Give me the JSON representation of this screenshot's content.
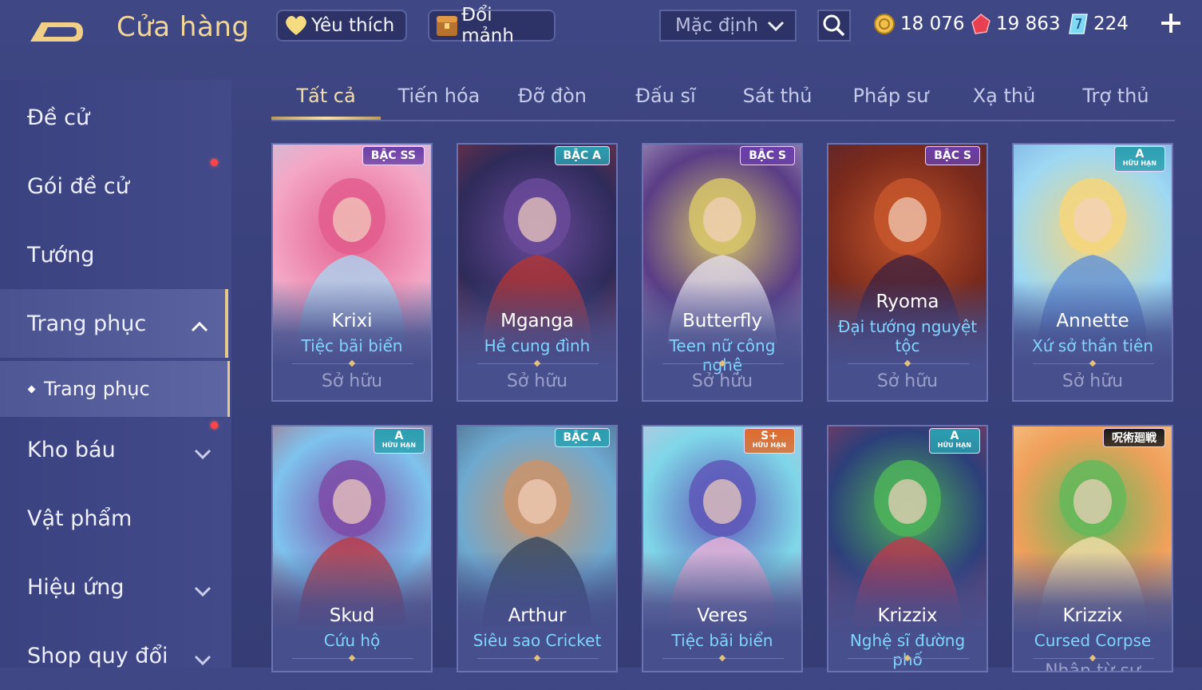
{
  "header": {
    "title": "Cửa hàng",
    "favorites_label": "Yêu thích",
    "exchange_label": "Đổi mảnh",
    "sort_value": "Mặc định",
    "gold": "18 076",
    "rubies": "19 863",
    "vouchers": "224"
  },
  "sidebar": {
    "items": [
      {
        "label": "Đề cử"
      },
      {
        "label": "Gói đề cử"
      },
      {
        "label": "Tướng"
      },
      {
        "label": "Trang phục"
      },
      {
        "label": "Kho báu"
      },
      {
        "label": "Vật phẩm"
      },
      {
        "label": "Hiệu ứng"
      },
      {
        "label": "Shop quy đổi"
      }
    ],
    "subitem": "Trang phục"
  },
  "tabs": [
    "Tất cả",
    "Tiến hóa",
    "Đỡ đòn",
    "Đấu sĩ",
    "Sát thủ",
    "Pháp sư",
    "Xạ thủ",
    "Trợ thủ"
  ],
  "cards": [
    {
      "hero": "Krixi",
      "skin": "Tiệc bãi biển",
      "status": "Sở hữu",
      "badge": "BẬC SS",
      "badge_color": "#6a3fa8",
      "art": [
        "#f4a6c4",
        "#e25d8d",
        "#a7d9f4"
      ]
    },
    {
      "hero": "Mganga",
      "skin": "Hề cung đình",
      "status": "Sở hữu",
      "badge": "BẬC A",
      "badge_color": "#2b9fb0",
      "art": [
        "#2e2b5a",
        "#6a4a9a",
        "#b8342f"
      ]
    },
    {
      "hero": "Butterfly",
      "skin": "Teen nữ công nghệ",
      "status": "Sở hữu",
      "badge": "BẬC S",
      "badge_color": "#6a3fa8",
      "art": [
        "#5a3d86",
        "#d7c66a",
        "#e7e2f0"
      ]
    },
    {
      "hero": "Ryoma",
      "skin": "Đại tướng nguyệt tộc",
      "status": "Sở hữu",
      "badge": "BẬC S",
      "badge_color": "#6a3fa8",
      "art": [
        "#7a2a1c",
        "#c5562c",
        "#3b2040"
      ]
    },
    {
      "hero": "Annette",
      "skin": "Xứ sở thần tiên",
      "status": "Sở hữu",
      "badge": "A",
      "badge_sub": "HỮU HẠN",
      "badge_color": "#2b9fb0",
      "art": [
        "#9ed8f2",
        "#f6d67c",
        "#5b8ed8"
      ]
    },
    {
      "hero": "Skud",
      "skin": "Cứu hộ",
      "status": "",
      "badge": "A",
      "badge_sub": "HỮU HẠN",
      "badge_color": "#2b9fb0",
      "art": [
        "#7ec3ee",
        "#7d4ca8",
        "#c2363a"
      ]
    },
    {
      "hero": "Arthur",
      "skin": "Siêu sao Cricket",
      "status": "",
      "badge": "BẬC A",
      "badge_color": "#2b9fb0",
      "art": [
        "#6fa9cf",
        "#c9946d",
        "#2f3d57"
      ]
    },
    {
      "hero": "Veres",
      "skin": "Tiệc bãi biển",
      "status": "",
      "badge": "S+",
      "badge_sub": "HỮU HẠN",
      "badge_color": "#e06a2a",
      "art": [
        "#7fd6e8",
        "#5e58b8",
        "#f4b6d8"
      ]
    },
    {
      "hero": "Krizzix",
      "skin": "Nghệ sĩ đường phố",
      "status": "",
      "badge": "A",
      "badge_sub": "HỮU HẠN",
      "badge_color": "#2b9fb0",
      "art": [
        "#2c3f7a",
        "#4db35a",
        "#c8364a"
      ]
    },
    {
      "hero": "Krizzix",
      "skin": "Cursed Corpse",
      "status": "Nhận từ sự",
      "badge": "呪術廻戦",
      "badge_color": "#1a1a1a",
      "art": [
        "#f0a05a",
        "#64b85a",
        "#f6e2b0"
      ]
    }
  ]
}
